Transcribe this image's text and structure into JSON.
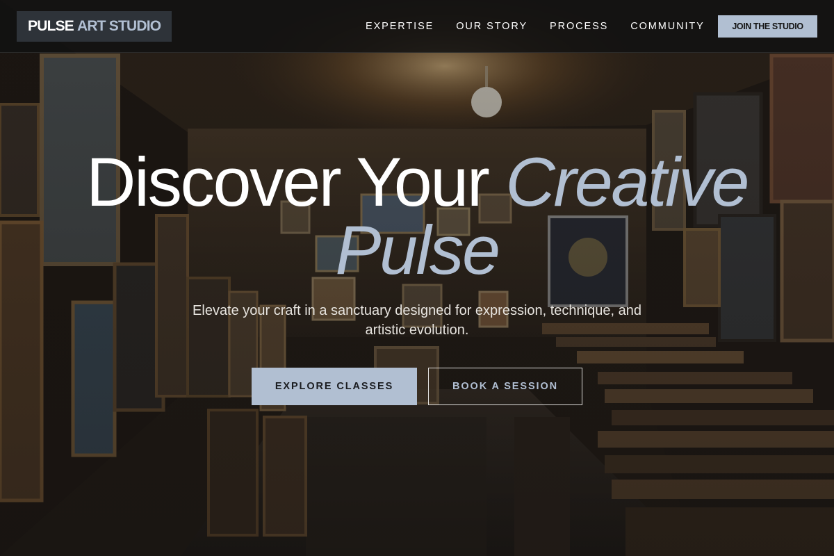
{
  "header": {
    "logo": {
      "word1": "PULSE",
      "word2": "ART STUDIO"
    },
    "nav": [
      {
        "label": "EXPERTISE"
      },
      {
        "label": "OUR STORY"
      },
      {
        "label": "PROCESS"
      },
      {
        "label": "COMMUNITY"
      }
    ],
    "cta_label": "JOIN THE STUDIO"
  },
  "hero": {
    "title_plain": "Discover Your ",
    "title_accent": "Creative Pulse",
    "subtitle": "Elevate your craft in a sanctuary designed for expression, technique, and artistic evolution.",
    "primary_button": "EXPLORE CLASSES",
    "secondary_button": "BOOK A SESSION"
  },
  "colors": {
    "accent": "#b1bfd2",
    "header_bg": "#121212",
    "logo_bg": "#2e3339",
    "text": "#ffffff"
  }
}
